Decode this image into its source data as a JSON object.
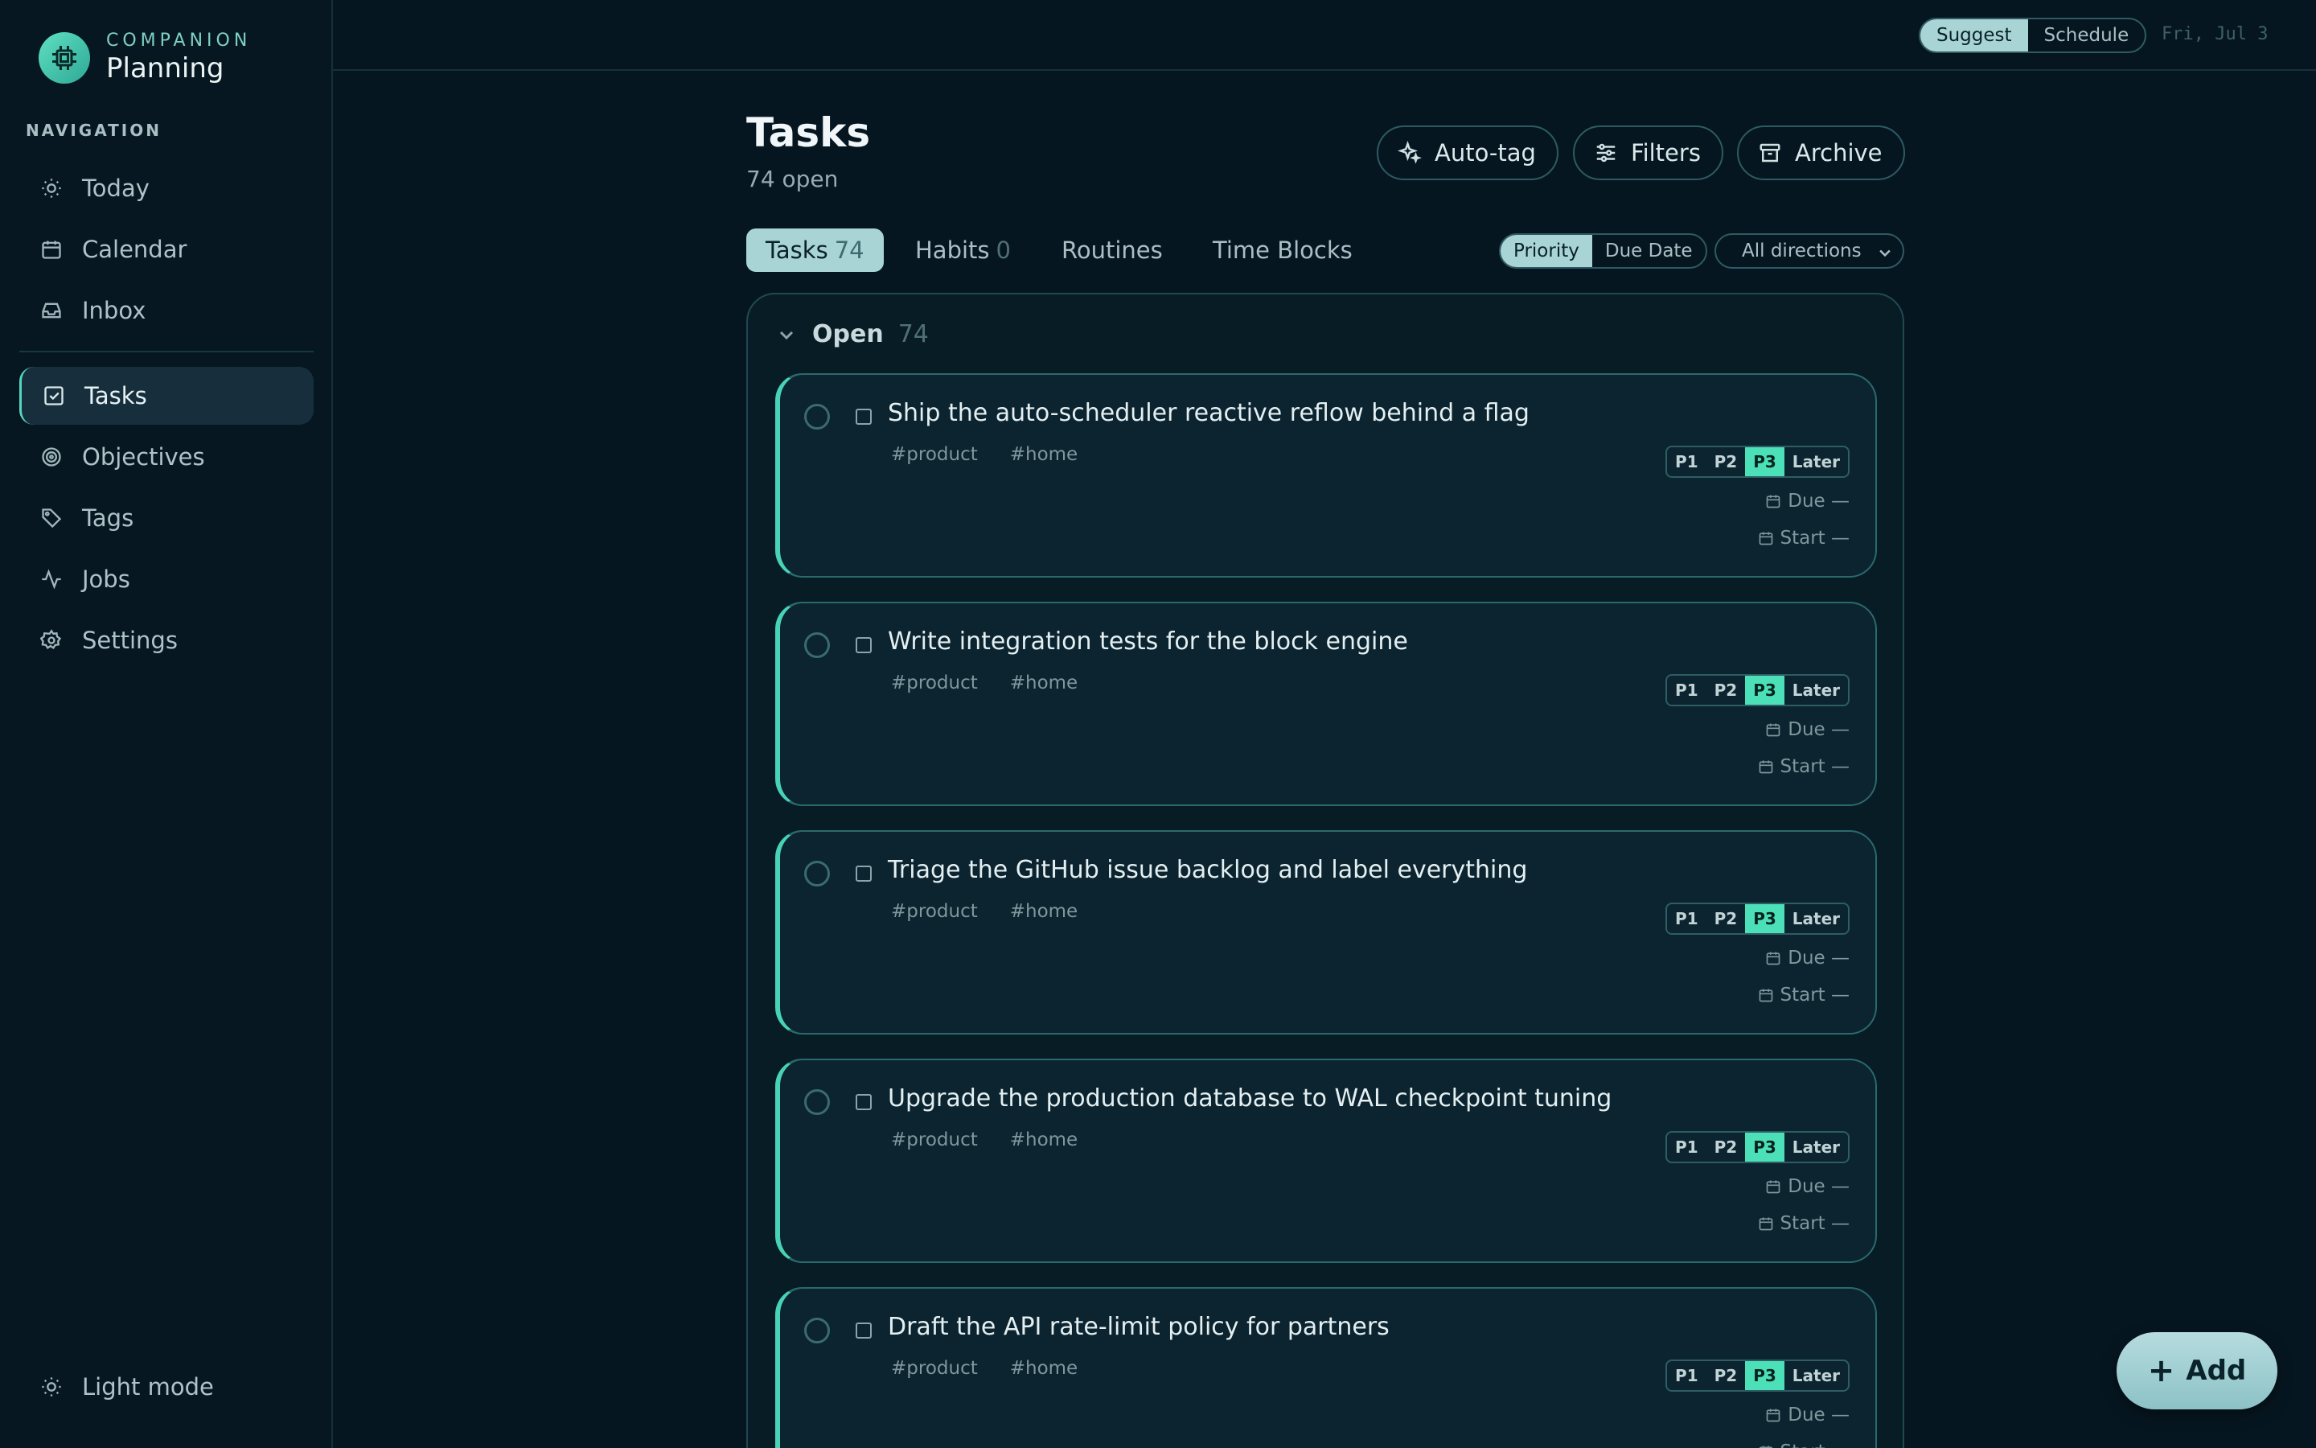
{
  "brand": {
    "kicker": "COMPANION",
    "title": "Planning"
  },
  "nav": {
    "heading": "NAVIGATION",
    "items": [
      {
        "label": "Today",
        "icon": "sun-icon"
      },
      {
        "label": "Calendar",
        "icon": "calendar-icon"
      },
      {
        "label": "Inbox",
        "icon": "inbox-icon"
      },
      {
        "label": "Tasks",
        "icon": "check-square-icon",
        "active": true
      },
      {
        "label": "Objectives",
        "icon": "target-icon"
      },
      {
        "label": "Tags",
        "icon": "tag-icon"
      },
      {
        "label": "Jobs",
        "icon": "activity-icon"
      },
      {
        "label": "Settings",
        "icon": "gear-icon"
      }
    ],
    "theme_toggle": "Light mode"
  },
  "topbar": {
    "modes": [
      "Suggest",
      "Schedule"
    ],
    "active_mode": "Suggest",
    "date": "Fri, Jul 3"
  },
  "header": {
    "title": "Tasks",
    "subtitle": "74 open",
    "buttons": {
      "autotag": "Auto-tag",
      "filters": "Filters",
      "archive": "Archive"
    }
  },
  "tabs": [
    {
      "label": "Tasks",
      "count": "74",
      "active": true
    },
    {
      "label": "Habits",
      "count": "0"
    },
    {
      "label": "Routines",
      "count": ""
    },
    {
      "label": "Time Blocks",
      "count": ""
    }
  ],
  "sort": {
    "options": [
      "Priority",
      "Due Date"
    ],
    "active": "Priority",
    "direction": "All directions"
  },
  "group": {
    "label": "Open",
    "count": "74"
  },
  "priority_levels": [
    "P1",
    "P2",
    "P3",
    "Later"
  ],
  "meta_labels": {
    "due": "Due —",
    "start": "Start —"
  },
  "tasks": [
    {
      "title": "Ship the auto-scheduler reactive reflow behind a flag",
      "tags": [
        "#product",
        "#home"
      ],
      "priority": "P3"
    },
    {
      "title": "Write integration tests for the block engine",
      "tags": [
        "#product",
        "#home"
      ],
      "priority": "P3"
    },
    {
      "title": "Triage the GitHub issue backlog and label everything",
      "tags": [
        "#product",
        "#home"
      ],
      "priority": "P3"
    },
    {
      "title": "Upgrade the production database to WAL checkpoint tuning",
      "tags": [
        "#product",
        "#home"
      ],
      "priority": "P3"
    },
    {
      "title": "Draft the API rate-limit policy for partners",
      "tags": [
        "#product",
        "#home"
      ],
      "priority": "P3"
    }
  ],
  "fab": {
    "label": "Add"
  },
  "colors": {
    "background": "#061620",
    "accent": "#48d2b6",
    "active_pill": "#a9d4d6",
    "priority_on": "#4be0b8"
  }
}
